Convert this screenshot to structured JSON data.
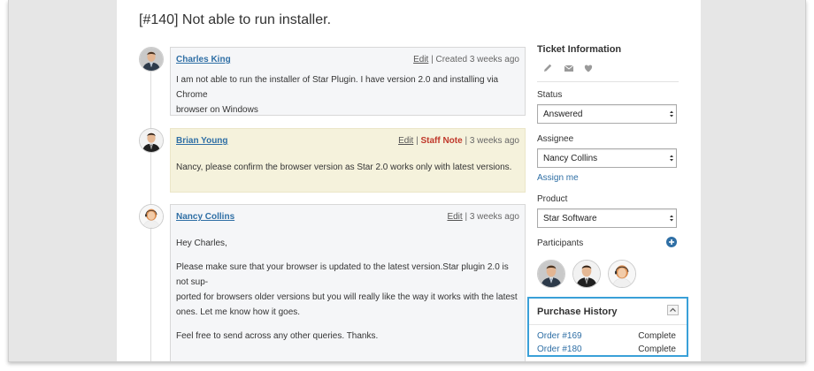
{
  "ticket": {
    "title": "[#140] Not able to run installer."
  },
  "comments": [
    {
      "author": "Charles King",
      "edit": "Edit",
      "time": "Created 3 weeks ago",
      "body": [
        "I am not able to run the installer of Star Plugin. I have version 2.0 and installing via Chrome",
        "browser on Windows"
      ]
    },
    {
      "author": "Brian Young",
      "edit": "Edit",
      "badge": "Staff Note",
      "time": "3 weeks ago",
      "body": [
        "Nancy, please confirm the browser version as Star 2.0 works only with latest versions."
      ]
    },
    {
      "author": "Nancy Collins",
      "edit": "Edit",
      "time": "3 weeks ago",
      "body": [
        "Hey Charles,",
        "Please make sure that your browser is updated to the latest version.Star plugin 2.0 is not sup-",
        "ported for browsers older versions but  you will really like the way it works with the latest",
        "ones. Let me know how it goes.",
        "Feel free to send across any other queries.  Thanks."
      ]
    }
  ],
  "sidebar": {
    "title": "Ticket Information",
    "icons": [
      "pencil-icon",
      "envelope-icon",
      "heart-icon"
    ],
    "status": {
      "label": "Status",
      "value": "Answered"
    },
    "assignee": {
      "label": "Assignee",
      "value": "Nancy Collins",
      "assign_me": "Assign me"
    },
    "product": {
      "label": "Product",
      "value": "Star Software"
    },
    "participants": {
      "label": "Participants"
    }
  },
  "purchase_history": {
    "title": "Purchase History",
    "orders": [
      {
        "id": "Order #169",
        "status": "Complete"
      },
      {
        "id": "Order #180",
        "status": "Complete"
      }
    ]
  },
  "colors": {
    "link": "#2f6fa5",
    "staff_note": "#c0392b",
    "staff_bg": "#f5f2dc",
    "highlight_border": "#3aa0d8"
  }
}
